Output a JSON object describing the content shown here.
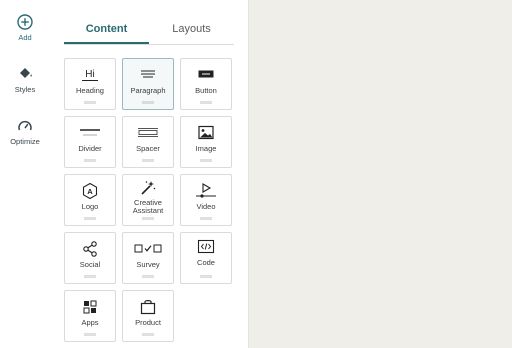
{
  "rail": {
    "add_label": "Add",
    "styles_label": "Styles",
    "optimize_label": "Optimize"
  },
  "tabs": {
    "content_label": "Content",
    "layouts_label": "Layouts",
    "active": "Content"
  },
  "blocks": [
    {
      "label": "Heading",
      "icon": "heading-icon"
    },
    {
      "label": "Paragraph",
      "icon": "paragraph-icon"
    },
    {
      "label": "Button",
      "icon": "button-icon"
    },
    {
      "label": "Divider",
      "icon": "divider-icon"
    },
    {
      "label": "Spacer",
      "icon": "spacer-icon"
    },
    {
      "label": "Image",
      "icon": "image-icon"
    },
    {
      "label": "Logo",
      "icon": "logo-icon"
    },
    {
      "label": "Creative Assistant",
      "icon": "magic-wand-icon"
    },
    {
      "label": "Video",
      "icon": "video-icon"
    },
    {
      "label": "Social",
      "icon": "share-icon"
    },
    {
      "label": "Survey",
      "icon": "survey-icon"
    },
    {
      "label": "Code",
      "icon": "code-icon"
    },
    {
      "label": "Apps",
      "icon": "apps-icon"
    },
    {
      "label": "Product",
      "icon": "shopping-bag-icon"
    }
  ],
  "icon_glyphs": {
    "heading": "Hi",
    "logo": "A"
  },
  "colors": {
    "accent": "#2a6b73",
    "canvas_bg": "#efeee8"
  }
}
